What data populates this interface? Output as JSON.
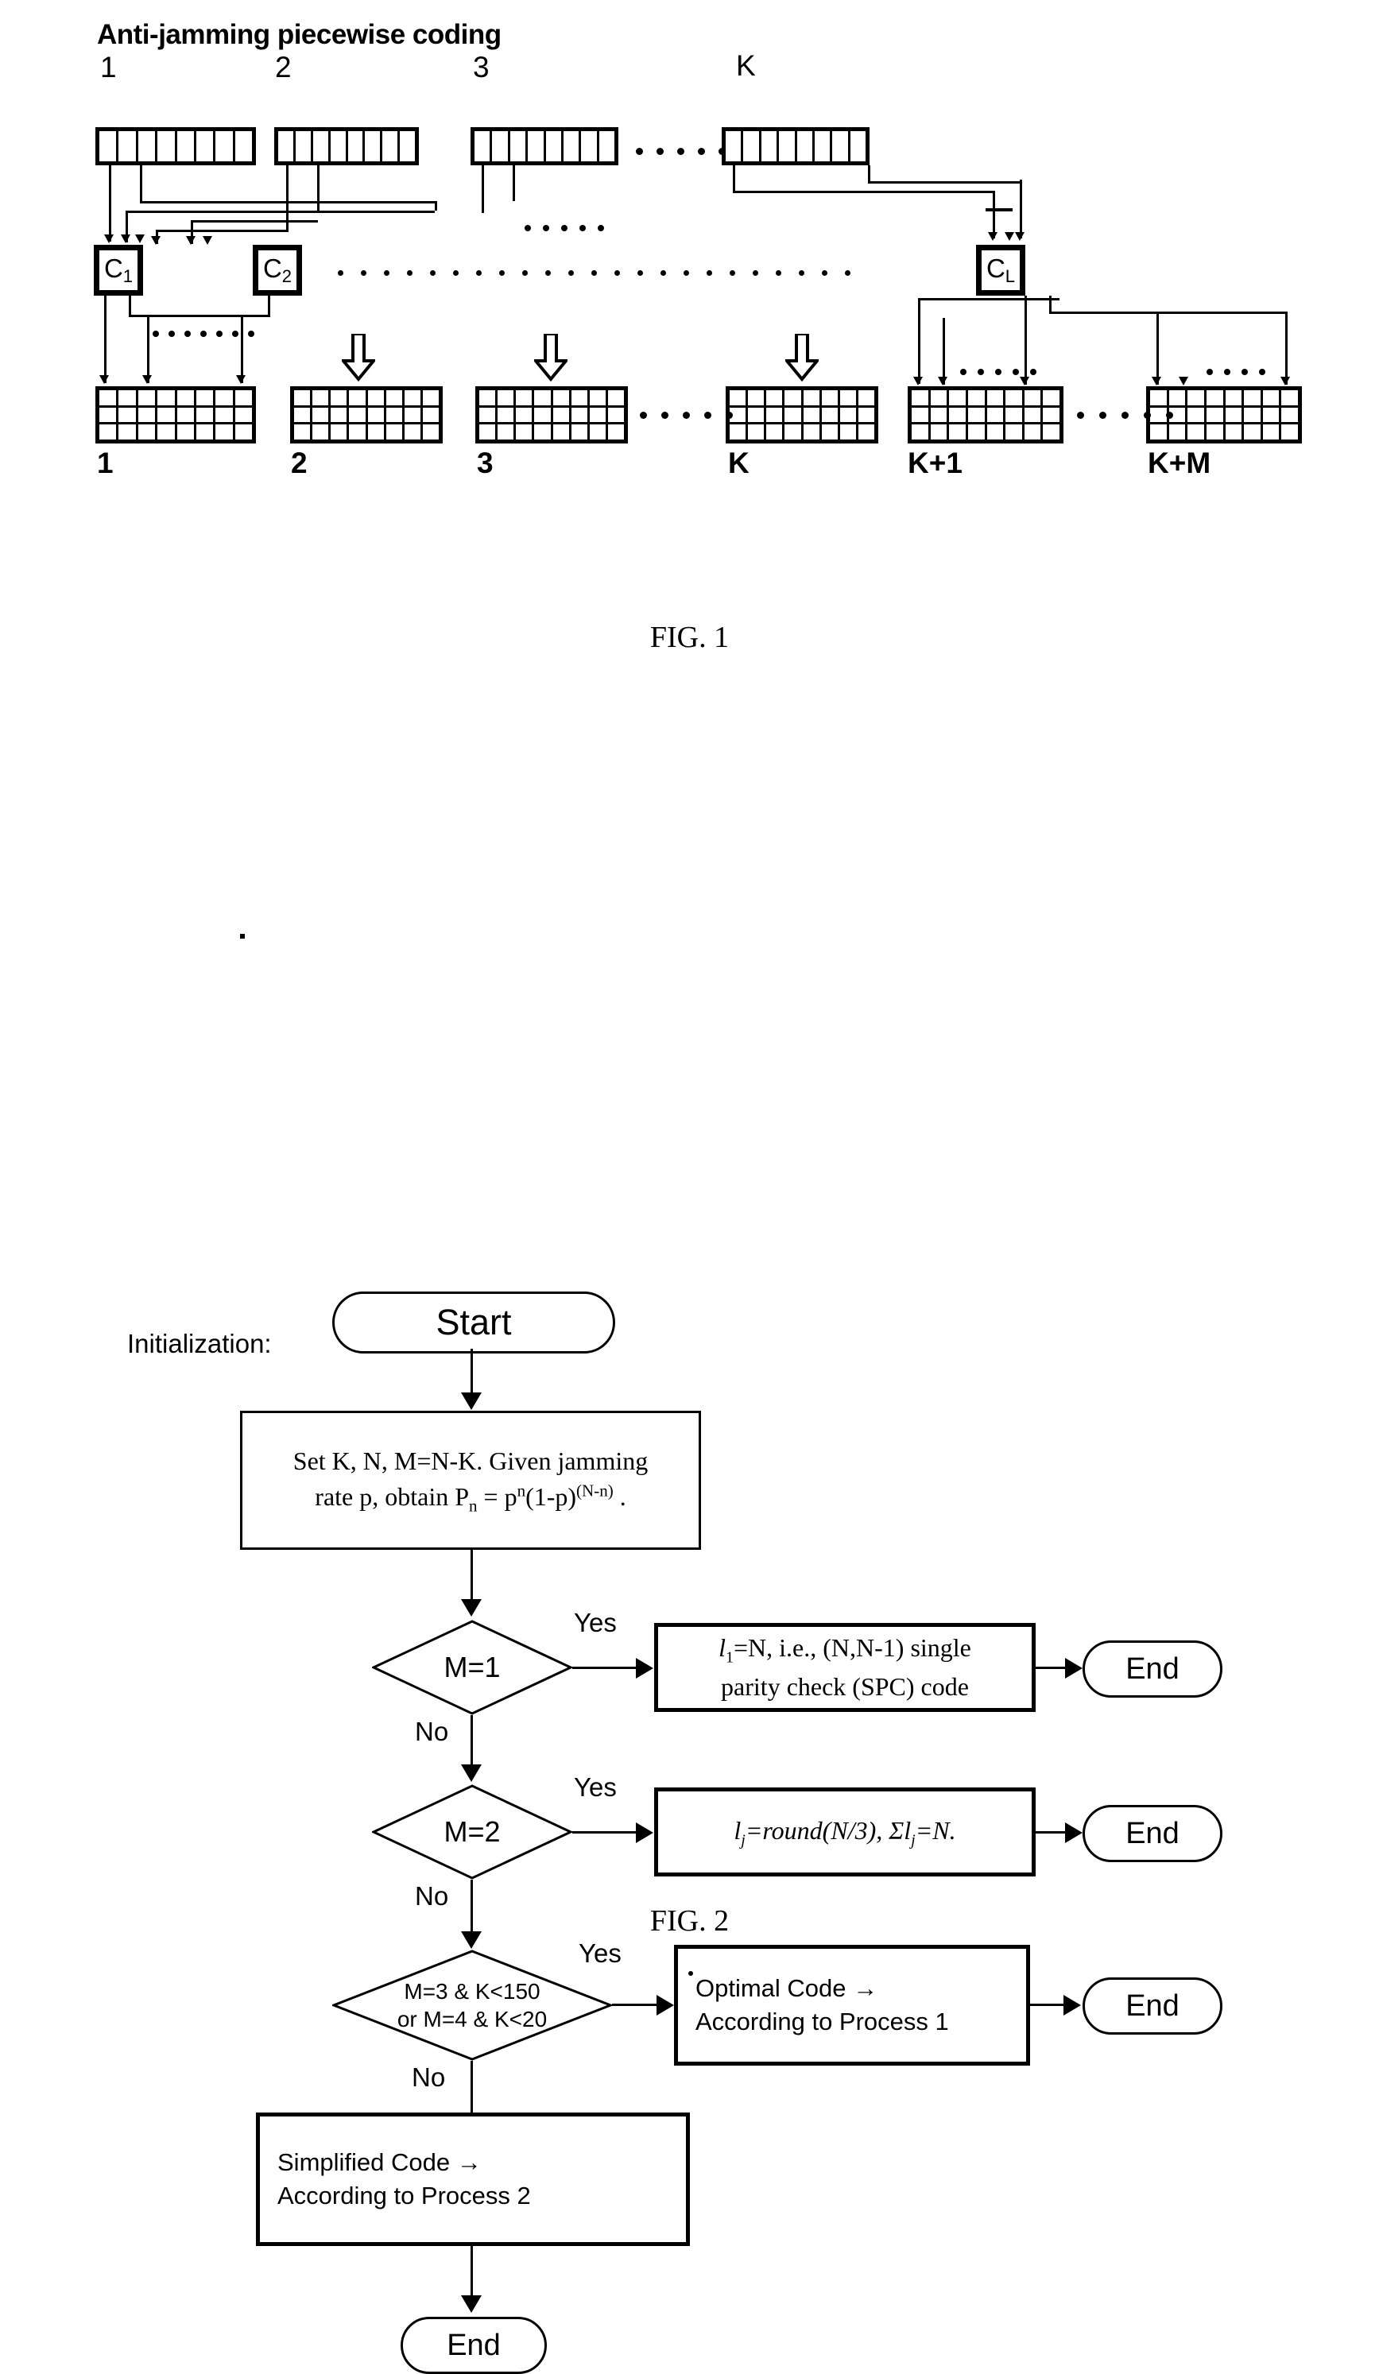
{
  "figure1": {
    "title": "Anti-jamming piecewise coding",
    "caption": "FIG. 1",
    "top_blocks": [
      {
        "label": "1",
        "cells": 8
      },
      {
        "label": "2",
        "cells": 8
      },
      {
        "label": "3",
        "cells": 8
      },
      {
        "label": "K",
        "cells": 8
      }
    ],
    "coder_boxes": [
      {
        "base": "C",
        "sub": "1"
      },
      {
        "base": "C",
        "sub": "2"
      },
      {
        "base": "C",
        "sub": "L"
      }
    ],
    "bottom_blocks": [
      {
        "label": "1",
        "cols": 8,
        "rows": 3
      },
      {
        "label": "2",
        "cols": 8,
        "rows": 3
      },
      {
        "label": "3",
        "cols": 8,
        "rows": 3
      },
      {
        "label": "K",
        "cols": 8,
        "rows": 3
      },
      {
        "label": "K+1",
        "cols": 8,
        "rows": 3
      },
      {
        "label": "K+M",
        "cols": 8,
        "rows": 3
      }
    ],
    "ellipsis": "• • • • •"
  },
  "figure2": {
    "caption": "FIG. 2",
    "initialization_label": "Initialization:",
    "start_label": "Start",
    "end_label": "End",
    "yes_label": "Yes",
    "no_label": "No",
    "init_box": {
      "line1": "Set K, N, M=N-K. Given jamming",
      "line2_pre": "rate p, obtain P",
      "line2_sub": "n",
      "line2_mid": " = p",
      "line2_sup1": "n",
      "line2_post": "(1-p)",
      "line2_sup2": "(N-n)",
      "line2_end": " ."
    },
    "decisions": [
      {
        "id": "m1",
        "text": "M=1"
      },
      {
        "id": "m2",
        "text": "M=2"
      },
      {
        "id": "m3",
        "line1": "M=3 & K<150",
        "line2": "or M=4 & K<20"
      }
    ],
    "actions": [
      {
        "id": "spc",
        "l": "l",
        "sub": "1",
        "line1_rest": "=N, i.e., (N,N-1) single",
        "line2": "parity check (SPC) code"
      },
      {
        "id": "round",
        "l": "l",
        "sub": "j",
        "mid": "=round(N/3), Σl",
        "sub2": "j",
        "end": "=N."
      },
      {
        "id": "optimal",
        "line1": "Optimal Code →",
        "line2": "According to Process 1"
      },
      {
        "id": "simplified",
        "line1": "Simplified Code →",
        "line2": "According to Process 2"
      }
    ]
  }
}
